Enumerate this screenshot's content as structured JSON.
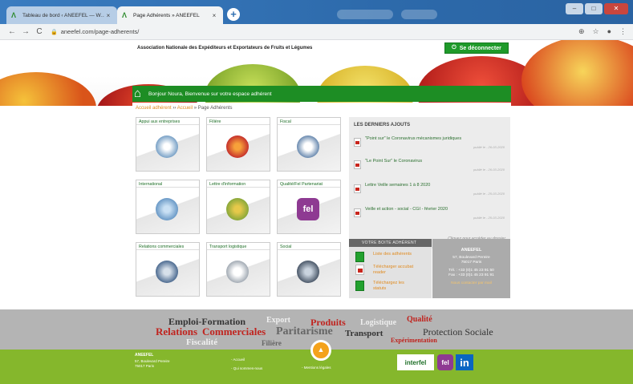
{
  "browser": {
    "tabs": [
      {
        "label": "Tableau de bord ‹ ANEEFEL — W…",
        "active": false
      },
      {
        "label": "Page Adhérents » ANEEFEL",
        "active": true
      }
    ],
    "close_glyph": "×",
    "newtab_glyph": "+",
    "url": "aneefel.com/page-adherents/",
    "nav": {
      "back": "←",
      "forward": "→",
      "reload": "C"
    }
  },
  "header": {
    "org_name": "Association Nationale des Expéditeurs et Exportateurs de Fruits et Légumes",
    "logout_label": "Se déconnecter",
    "welcome": "Bonjour Noura, Bienvenue sur votre espace adhérent"
  },
  "breadcrumb": {
    "part1": "Accueil adhérent",
    "sep": "››",
    "part2": "Accueil",
    "sep2": "»",
    "current": "Page Adhérents"
  },
  "cards": [
    {
      "title": "Appui aux entreprises",
      "icon": "handshake-icon",
      "color": "#7aa2c7"
    },
    {
      "title": "Filière",
      "icon": "fruit-bowl-icon",
      "color": "#c6322c"
    },
    {
      "title": "Fiscal",
      "icon": "calculator-icon",
      "color": "#5c7fa8"
    },
    {
      "title": "International",
      "icon": "globe-icon",
      "color": "#6b9ac7"
    },
    {
      "title": "Lettre d'information",
      "icon": "vegetables-icon",
      "color": "#8aa83a"
    },
    {
      "title": "Qualité/Fel Partenariat",
      "icon": "fel-logo-icon",
      "color": "#8e3a92"
    },
    {
      "title": "Relations commerciales",
      "icon": "people-icon",
      "color": "#4f6d92"
    },
    {
      "title": "Transport logistique",
      "icon": "truck-icon",
      "color": "#9aa3ad"
    },
    {
      "title": "Social",
      "icon": "group-icon",
      "color": "#4d5a6b"
    }
  ],
  "news": {
    "title": "LES DERNIERS AJOUTS",
    "items": [
      {
        "text": "\"Point sur\" le Coronavirus mécanismes juridiques",
        "date": "publié le - 26-03-2020"
      },
      {
        "text": "\"Le Point Sur\" le Coronavirus",
        "date": "publié le - 26-03-2020"
      },
      {
        "text": "Lettre Veille semaines 1 à 8 2020",
        "date": "publié le - 25-03-2020"
      },
      {
        "text": "Veille et action - social - CGI - février 2020",
        "date": "publié le - 25-03-2020"
      }
    ],
    "archive": "Cliquez pour accéder au dossier"
  },
  "docs": {
    "head": "VOTRE BOITE ADHÉRENT",
    "items": [
      {
        "text": "Liste des adhérents",
        "icon": "green-file-icon"
      },
      {
        "text": "Télécharger accubat reader",
        "icon": "pdf-icon"
      },
      {
        "text": "Téléchargez les statuts",
        "icon": "green-file-icon"
      }
    ]
  },
  "contact": {
    "name": "ANEEFEL",
    "addr1": "57, Boulevard Pereire",
    "addr2": "75017 Paris",
    "tel": "Tél. : +33 (0)1 45 23 91 50",
    "fax": "Fax : +33 (0)1 45 23 91 91",
    "link": "Nous contacter par mail"
  },
  "tagcloud": [
    {
      "text": "Emploi-Formation",
      "color": "#333333"
    },
    {
      "text": "Export",
      "color": "#f0f0f0"
    },
    {
      "text": "Produits",
      "color": "#c0241f"
    },
    {
      "text": "Logistique",
      "color": "#eeeeee"
    },
    {
      "text": "Qualité",
      "color": "#c0241f"
    },
    {
      "text": "Relations",
      "color": "#c0241f"
    },
    {
      "text": "Commerciales",
      "color": "#c0241f"
    },
    {
      "text": "Paritarisme",
      "color": "#666666"
    },
    {
      "text": "Transport",
      "color": "#333333"
    },
    {
      "text": "Protection Sociale",
      "color": "#333333"
    },
    {
      "text": "Fiscalité",
      "color": "#f0f0f0"
    },
    {
      "text": "Filière",
      "color": "#666666"
    },
    {
      "text": "Expérimentation",
      "color": "#c0241f"
    }
  ],
  "scroll_top_glyph": "▲",
  "footer": {
    "name": "ANEEFEL",
    "addr1": "57, Boulevard Pereire",
    "addr2": "75017 Paris",
    "links": [
      "- Accueil",
      "- Qui sommes-nous",
      "- Mentions légales"
    ],
    "logos": {
      "interfel": "interfel",
      "fel": "fel",
      "linkedin": "in"
    }
  },
  "colors": {
    "brand_green": "#1d8d24",
    "footer_green": "#85b72c",
    "accent_orange": "#e08a1e"
  }
}
